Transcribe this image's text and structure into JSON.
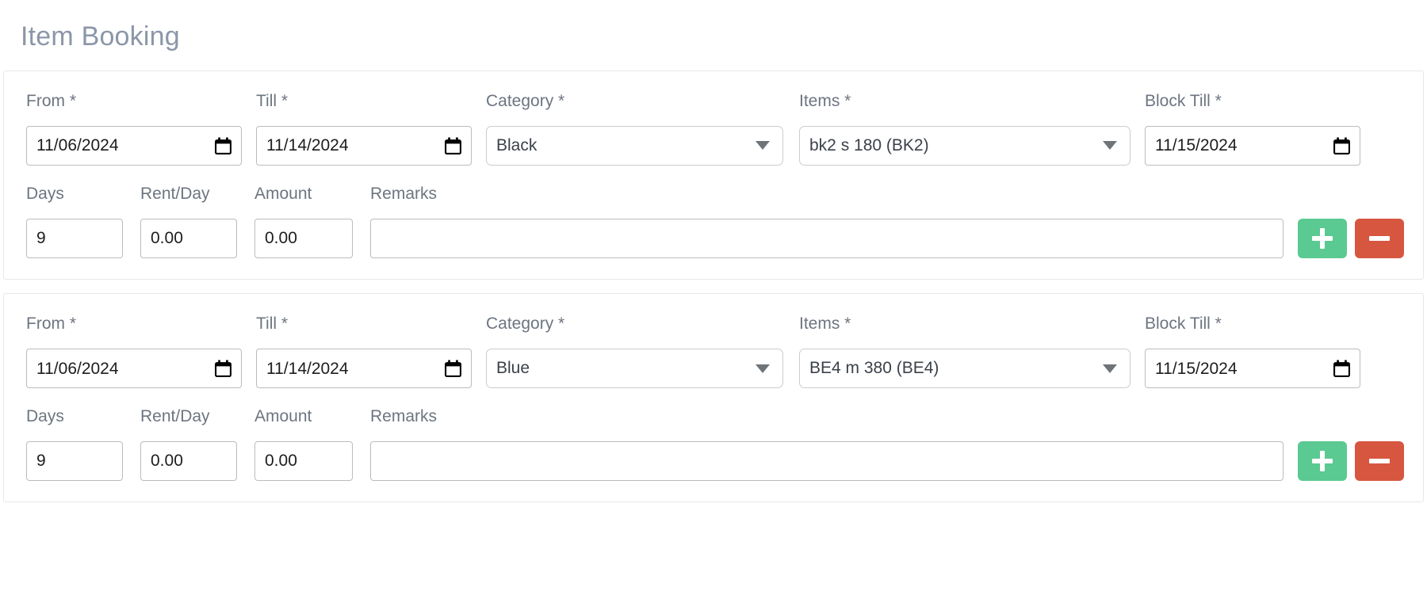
{
  "page": {
    "title": "Item Booking"
  },
  "labels": {
    "from": "From *",
    "till": "Till *",
    "category": "Category *",
    "items": "Items *",
    "block_till": "Block Till *",
    "days": "Days",
    "rent_per_day": "Rent/Day",
    "amount": "Amount",
    "remarks": "Remarks"
  },
  "icons": {
    "calendar": "calendar-icon",
    "dropdown_caret": "chevron-down-icon",
    "add": "plus-icon",
    "remove": "minus-icon"
  },
  "colors": {
    "title": "#8b96a8",
    "label": "#6d7580",
    "value": "#1d1d1f",
    "border": "#b9bcc0",
    "card_border": "#e6e8ec",
    "add_button": "#5bc992",
    "remove_button": "#d75640"
  },
  "actions": {
    "add_title": "Add",
    "remove_title": "Remove"
  },
  "bookings": [
    {
      "from": "11/06/2024",
      "till": "11/14/2024",
      "category": "Black",
      "items": "bk2 s 180 (BK2)",
      "block_till": "11/15/2024",
      "days": "9",
      "rent_per_day": "0.00",
      "amount": "0.00",
      "remarks": "",
      "remarks_placeholder": ""
    },
    {
      "from": "11/06/2024",
      "till": "11/14/2024",
      "category": "Blue",
      "items": "BE4 m 380 (BE4)",
      "block_till": "11/15/2024",
      "days": "9",
      "rent_per_day": "0.00",
      "amount": "0.00",
      "remarks": "",
      "remarks_placeholder": ""
    }
  ]
}
